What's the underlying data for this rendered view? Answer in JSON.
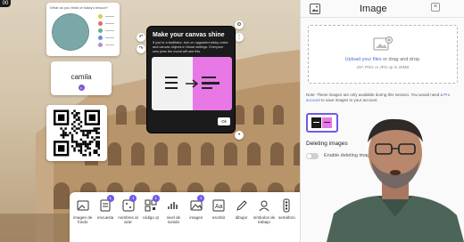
{
  "canvas": {
    "top_badge": "00",
    "poll": {
      "question": "What do you think of today's lesson?",
      "option_colors": [
        "#e4c84b",
        "#e07060",
        "#63b18a",
        "#6d8fd9",
        "#b48fd2"
      ]
    },
    "name_card": {
      "name": "camila",
      "avatar_letter": "c"
    },
    "qr_card": {}
  },
  "modal": {
    "title": "Make your canvas shine",
    "body": "If you're a facilitator, turn on upgraded sticky notes and canvas objects in Mural settings. Everyone who joins the mural will see this.",
    "ok_label": "Ok"
  },
  "side_tools": [
    "gear-icon",
    "undo-icon",
    "redo-icon",
    "more-icon"
  ],
  "toolbar": {
    "tools": [
      {
        "label": "imagen de fondo",
        "icon": "background-image-icon",
        "badge": ""
      },
      {
        "label": "encuesta",
        "icon": "poll-icon",
        "badge": "1"
      },
      {
        "label": "nombres al azar",
        "icon": "random-names-icon",
        "badge": "1"
      },
      {
        "label": "código qr",
        "icon": "qr-code-icon",
        "badge": "1"
      },
      {
        "label": "nivel de sonido",
        "icon": "sound-level-icon",
        "badge": ""
      },
      {
        "label": "imagen",
        "icon": "image-icon",
        "badge": "1"
      },
      {
        "label": "escribir",
        "icon": "text-icon",
        "badge": ""
      },
      {
        "label": "dibujar",
        "icon": "draw-icon",
        "badge": ""
      },
      {
        "label": "símbolos de trabajo",
        "icon": "work-symbols-icon",
        "badge": ""
      },
      {
        "label": "semáforo",
        "icon": "traffic-light-icon",
        "badge": ""
      }
    ]
  },
  "panel": {
    "title": "Image",
    "close_label": "×",
    "upload_link": "Upload your files",
    "upload_suffix": "or drag and drop.",
    "formats": "GIF, PNG or JPG up to 25MB",
    "note_before": "Note: These images are only available during this session. You would need a ",
    "note_link": "Pro account",
    "note_after": " to save images to your account.",
    "deleting_title": "Deleting images",
    "toggle_label": "Enable deleting images",
    "toggle_on": false,
    "accent_color": "#6d5ce8"
  }
}
